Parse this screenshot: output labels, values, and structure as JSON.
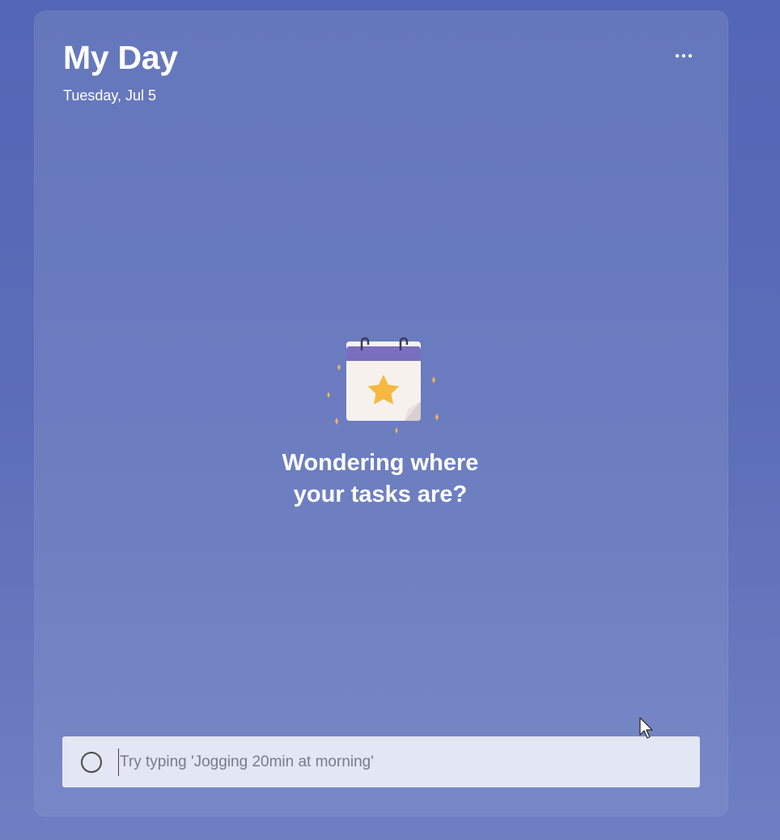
{
  "header": {
    "title": "My Day",
    "date": "Tuesday, Jul 5"
  },
  "toolbar": {
    "more_icon": "more-options-icon"
  },
  "empty_state": {
    "illustration_icon": "calendar-star-icon",
    "message_line1": "Wondering where",
    "message_line2": "your tasks are?"
  },
  "add_task": {
    "circle_icon": "circle-icon",
    "placeholder": "Try typing 'Jogging 20min at morning'",
    "value": ""
  },
  "colors": {
    "background": "#5466b6",
    "panel": "#6a7cbf",
    "input_bg": "#e3e6f3",
    "calendar_header": "#7a6fbf",
    "star": "#f6b83f"
  }
}
